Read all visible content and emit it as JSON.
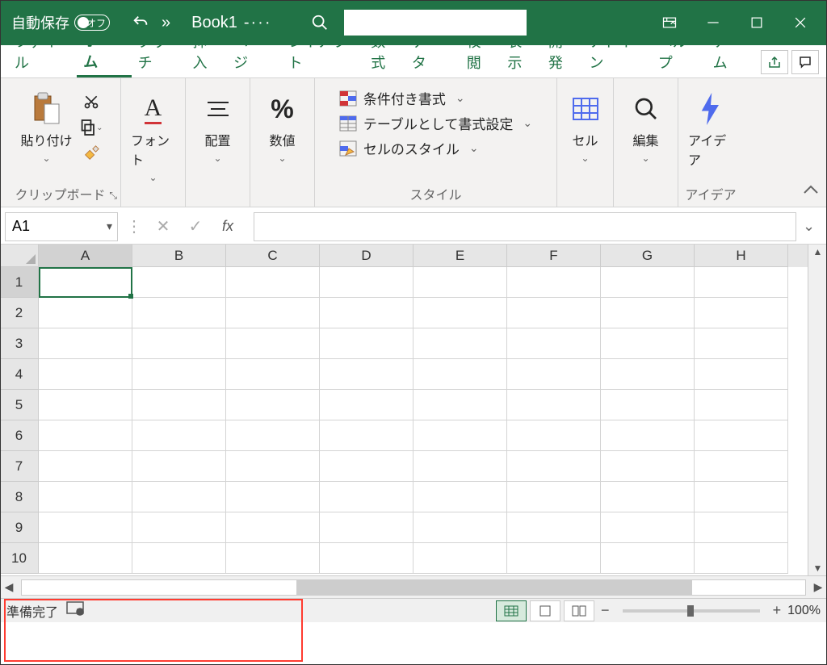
{
  "titlebar": {
    "autosave_label": "自動保存",
    "autosave_state": "オフ",
    "book_title": "Book1",
    "title_suffix": "-···"
  },
  "tabs": {
    "file": "ファイル",
    "home": "ホーム",
    "touch": "タッチ",
    "insert": "挿入",
    "page": "ページ",
    "layout": "レイアウト",
    "formulas": "数式",
    "data": "データ",
    "review": "校閲",
    "view": "表示",
    "developer": "開発",
    "addins": "アドイン",
    "help": "ヘルプ",
    "team": "チーム"
  },
  "ribbon": {
    "clipboard": {
      "paste": "貼り付け",
      "label": "クリップボード"
    },
    "font": {
      "button": "フォント"
    },
    "alignment": {
      "button": "配置"
    },
    "number": {
      "button": "数値"
    },
    "styles": {
      "conditional": "条件付き書式",
      "table": "テーブルとして書式設定",
      "cell_styles": "セルのスタイル",
      "label": "スタイル"
    },
    "cells": {
      "button": "セル"
    },
    "editing": {
      "button": "編集"
    },
    "ideas": {
      "button": "アイデア",
      "label": "アイデア"
    }
  },
  "formulabar": {
    "namebox": "A1",
    "value": ""
  },
  "grid": {
    "columns": [
      "A",
      "B",
      "C",
      "D",
      "E",
      "F",
      "G",
      "H"
    ],
    "rows": [
      "1",
      "2",
      "3",
      "4",
      "5",
      "6",
      "7",
      "8",
      "9",
      "10"
    ],
    "active_cell": "A1"
  },
  "statusbar": {
    "ready": "準備完了",
    "zoom": "100%"
  }
}
